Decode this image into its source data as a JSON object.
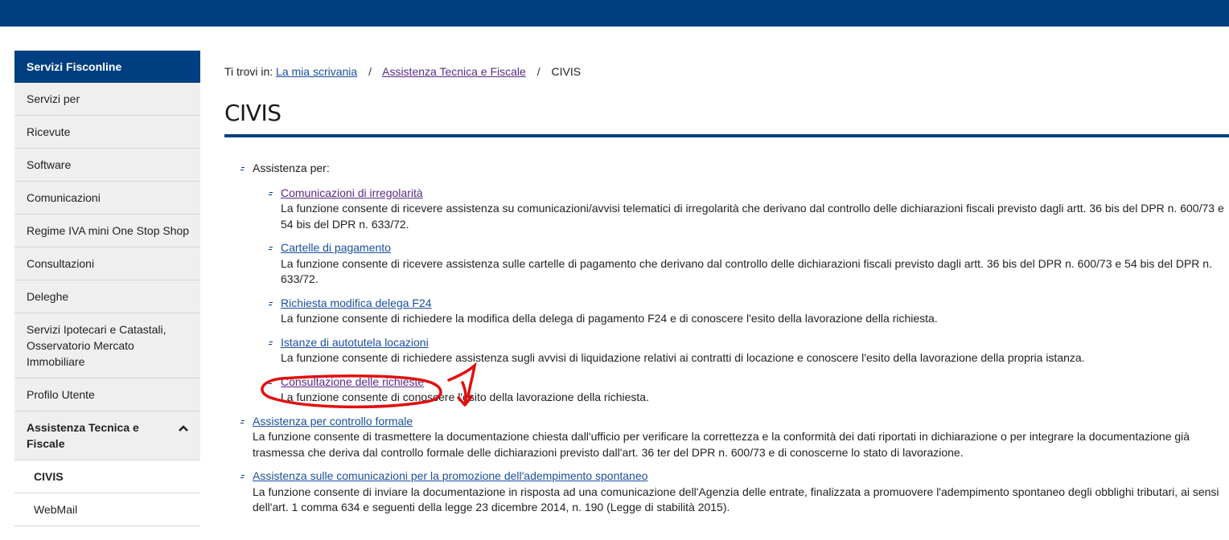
{
  "sidebar": {
    "header": "Servizi Fisconline",
    "items": [
      {
        "label": "Servizi per"
      },
      {
        "label": "Ricevute"
      },
      {
        "label": "Software"
      },
      {
        "label": "Comunicazioni"
      },
      {
        "label": "Regime IVA mini One Stop Shop"
      },
      {
        "label": "Consultazioni"
      },
      {
        "label": "Deleghe"
      },
      {
        "label": "Servizi Ipotecari e Catastali, Osservatorio Mercato Immobiliare"
      },
      {
        "label": "Profilo Utente"
      },
      {
        "label": "Assistenza Tecnica e Fiscale"
      }
    ],
    "subitems": [
      {
        "label": "CIVIS"
      },
      {
        "label": "WebMail"
      }
    ]
  },
  "breadcrumb": {
    "prefix": "Ti trovi in:",
    "links": [
      "La mia scrivania",
      "Assistenza Tecnica e Fiscale"
    ],
    "current": "CIVIS",
    "separator": "/"
  },
  "main": {
    "title": "CIVIS",
    "assistenza_label": "Assistenza per:",
    "subitems": [
      {
        "link": "Comunicazioni di irregolarità",
        "desc": "La funzione consente di ricevere assistenza su comunicazioni/avvisi telematici di irregolarità che derivano dal controllo delle dichiarazioni fiscali previsto dagli artt. 36 bis del DPR n. 600/73 e 54 bis del DPR n. 633/72."
      },
      {
        "link": "Cartelle di pagamento",
        "desc": "La funzione consente di ricevere assistenza sulle cartelle di pagamento che derivano dal controllo delle dichiarazioni fiscali previsto dagli artt. 36 bis del DPR n. 600/73 e 54 bis del DPR n. 633/72."
      },
      {
        "link": "Richiesta modifica delega F24",
        "desc": "La funzione consente di richiedere la modifica della delega di pagamento F24 e di conoscere l'esito della lavorazione della richiesta."
      },
      {
        "link": "Istanze di autotutela locazioni",
        "desc": "La funzione consente di richiedere assistenza sugli avvisi di liquidazione relativi ai contratti di locazione e conoscere l'esito della lavorazione della propria istanza."
      },
      {
        "link": "Consultazione delle richieste",
        "desc": "La funzione consente di conoscere l'esito della lavorazione della richiesta."
      }
    ],
    "topitems": [
      {
        "link": "Assistenza per controllo formale",
        "desc": "La funzione consente di trasmettere la documentazione chiesta dall'ufficio per verificare la correttezza e la conformità dei dati riportati in dichiarazione o per integrare la documentazione già trasmessa che deriva dal controllo formale delle dichiarazioni previsto dall'art. 36 ter del DPR n. 600/73 e di conoscerne lo stato di lavorazione."
      },
      {
        "link": "Assistenza sulle comunicazioni per la promozione dell'adempimento spontaneo",
        "desc": "La funzione consente di inviare la documentazione in risposta ad una comunicazione dell'Agenzia delle entrate, finalizzata a promuovere l'adempimento spontaneo degli obblighi tributari, ai sensi dell'art. 1 comma 634 e seguenti della legge 23 dicembre 2014, n. 190 (Legge di stabilità 2015)."
      }
    ]
  },
  "annotation": {
    "number": "1",
    "color": "#e01010"
  },
  "colors": {
    "brand": "#003e82",
    "link": "#1a4f9c",
    "visited": "#5b2a86"
  }
}
